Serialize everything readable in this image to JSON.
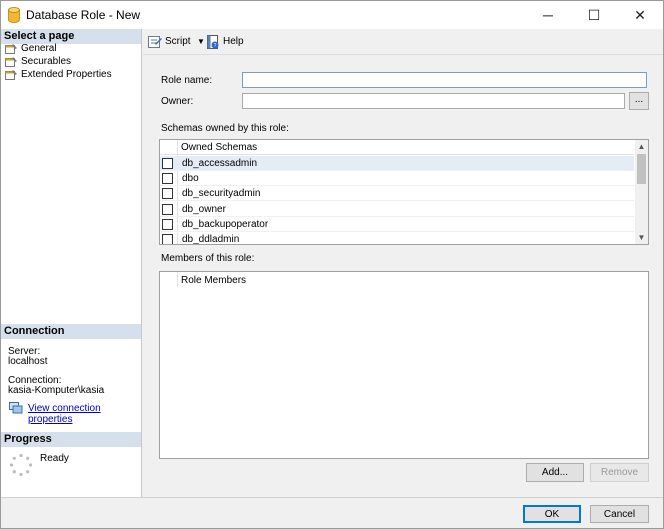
{
  "window": {
    "title": "Database Role - New",
    "minimize_glyph": "─",
    "maximize_glyph": "☐",
    "close_glyph": "✕"
  },
  "left_panel": {
    "select_page_header": "Select a page",
    "pages": [
      {
        "label": "General",
        "icon": "wrench-page-icon"
      },
      {
        "label": "Securables",
        "icon": "wrench-page-icon"
      },
      {
        "label": "Extended Properties",
        "icon": "wrench-page-icon"
      }
    ],
    "connection_header": "Connection",
    "server_label": "Server:",
    "server_value": "localhost",
    "connection_label": "Connection:",
    "connection_value": "kasia-Komputer\\kasia",
    "view_connection_link": "View connection properties",
    "progress_header": "Progress",
    "progress_status": "Ready"
  },
  "toolbar": {
    "script_label": "Script",
    "help_label": "Help"
  },
  "general": {
    "role_name_label": "Role name:",
    "role_name_value": "",
    "owner_label": "Owner:",
    "owner_value": "",
    "browse_label": "...",
    "schemas_label": "Schemas owned by this role:",
    "schemas_header": "Owned Schemas",
    "schemas": [
      {
        "name": "db_accessadmin",
        "checked": false,
        "selected": true
      },
      {
        "name": "dbo",
        "checked": false,
        "selected": false
      },
      {
        "name": "db_securityadmin",
        "checked": false,
        "selected": false
      },
      {
        "name": "db_owner",
        "checked": false,
        "selected": false
      },
      {
        "name": "db_backupoperator",
        "checked": false,
        "selected": false
      },
      {
        "name": "db_ddladmin",
        "checked": false,
        "selected": false
      }
    ],
    "members_label": "Members of this role:",
    "members_header": "Role Members",
    "members": [],
    "add_label": "Add...",
    "remove_label": "Remove"
  },
  "dialog_buttons": {
    "ok_label": "OK",
    "cancel_label": "Cancel"
  },
  "colors": {
    "section_header_bg": "#d6e0ec",
    "link": "#0000cc",
    "accent": "#0078d7"
  }
}
